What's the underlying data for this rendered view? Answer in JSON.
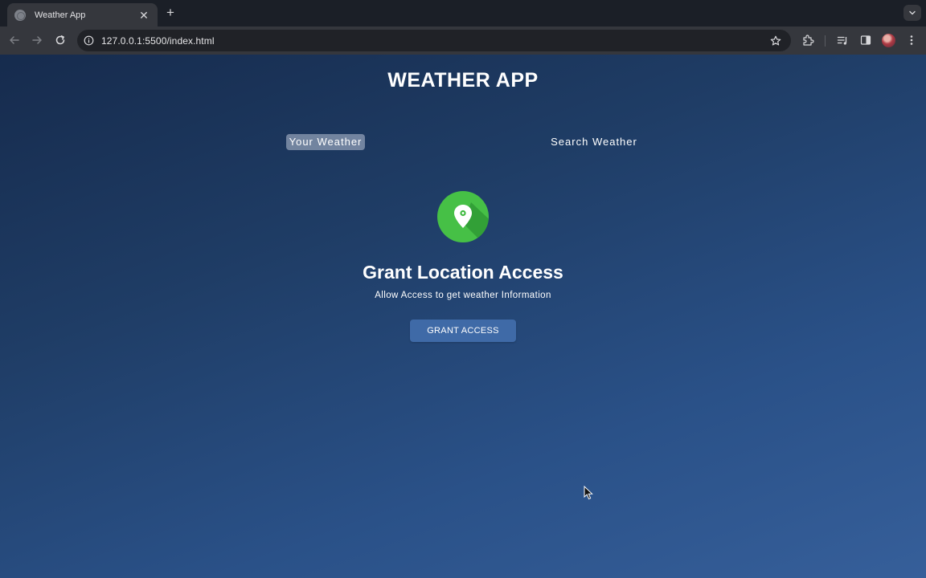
{
  "browser": {
    "tab": {
      "title": "Weather App",
      "close_glyph": "✕"
    },
    "new_tab_glyph": "+",
    "url": "127.0.0.1:5500/index.html",
    "icons": [
      "back-arrow-icon",
      "forward-arrow-icon",
      "reload-icon",
      "site-info-icon",
      "bookmark-star-icon",
      "extensions-icon",
      "media-controls-icon",
      "side-panel-icon",
      "profile-avatar",
      "more-menu-icon"
    ]
  },
  "app": {
    "title": "WEATHER APP",
    "tabs": [
      {
        "label": "Your Weather",
        "active": true
      },
      {
        "label": "Search Weather",
        "active": false
      }
    ],
    "grant": {
      "icon": "location-pin-icon",
      "title": "Grant Location Access",
      "subtitle": "Allow Access to get weather Information",
      "button_label": "GRANT ACCESS"
    }
  },
  "colors": {
    "accent_button": "#3f6aa7",
    "icon_green": "#3fba3f",
    "active_tab": "#8a9ab3"
  }
}
